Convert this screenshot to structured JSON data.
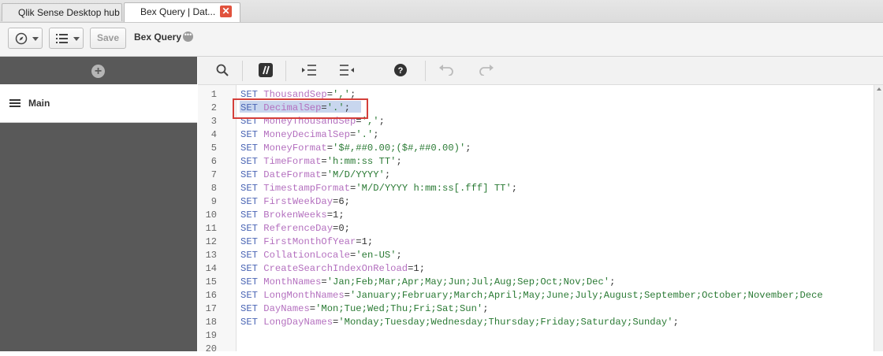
{
  "tabs": [
    {
      "label": "Qlik Sense Desktop hub"
    },
    {
      "label": "Bex Query | Dat..."
    }
  ],
  "toolbar": {
    "save_label": "Save",
    "app_title": "Bex Query"
  },
  "left_panel": {
    "section_label": "Main"
  },
  "editor": {
    "lines": [
      {
        "n": "1",
        "parts": [
          {
            "t": "SET ",
            "c": "kw"
          },
          {
            "t": "ThousandSep",
            "c": "var"
          },
          {
            "t": "=",
            "c": "pun"
          },
          {
            "t": "','",
            "c": "str"
          },
          {
            "t": ";",
            "c": "pun"
          }
        ]
      },
      {
        "n": "2",
        "parts": [
          {
            "t": "SET ",
            "c": "kw"
          },
          {
            "t": "DecimalSep",
            "c": "var"
          },
          {
            "t": "=",
            "c": "pun"
          },
          {
            "t": "'.'",
            "c": "str"
          },
          {
            "t": ";",
            "c": "pun"
          }
        ]
      },
      {
        "n": "3",
        "parts": [
          {
            "t": "SET ",
            "c": "kw"
          },
          {
            "t": "MoneyThousandSep",
            "c": "var"
          },
          {
            "t": "=",
            "c": "pun"
          },
          {
            "t": "','",
            "c": "str"
          },
          {
            "t": ";",
            "c": "pun"
          }
        ]
      },
      {
        "n": "4",
        "parts": [
          {
            "t": "SET ",
            "c": "kw"
          },
          {
            "t": "MoneyDecimalSep",
            "c": "var"
          },
          {
            "t": "=",
            "c": "pun"
          },
          {
            "t": "'.'",
            "c": "str"
          },
          {
            "t": ";",
            "c": "pun"
          }
        ]
      },
      {
        "n": "5",
        "parts": [
          {
            "t": "SET ",
            "c": "kw"
          },
          {
            "t": "MoneyFormat",
            "c": "var"
          },
          {
            "t": "=",
            "c": "pun"
          },
          {
            "t": "'$#,##0.00;($#,##0.00)'",
            "c": "str"
          },
          {
            "t": ";",
            "c": "pun"
          }
        ]
      },
      {
        "n": "6",
        "parts": [
          {
            "t": "SET ",
            "c": "kw"
          },
          {
            "t": "TimeFormat",
            "c": "var"
          },
          {
            "t": "=",
            "c": "pun"
          },
          {
            "t": "'h:mm:ss TT'",
            "c": "str"
          },
          {
            "t": ";",
            "c": "pun"
          }
        ]
      },
      {
        "n": "7",
        "parts": [
          {
            "t": "SET ",
            "c": "kw"
          },
          {
            "t": "DateFormat",
            "c": "var"
          },
          {
            "t": "=",
            "c": "pun"
          },
          {
            "t": "'M/D/YYYY'",
            "c": "str"
          },
          {
            "t": ";",
            "c": "pun"
          }
        ]
      },
      {
        "n": "8",
        "parts": [
          {
            "t": "SET ",
            "c": "kw"
          },
          {
            "t": "TimestampFormat",
            "c": "var"
          },
          {
            "t": "=",
            "c": "pun"
          },
          {
            "t": "'M/D/YYYY h:mm:ss[.fff] TT'",
            "c": "str"
          },
          {
            "t": ";",
            "c": "pun"
          }
        ]
      },
      {
        "n": "9",
        "parts": [
          {
            "t": "SET ",
            "c": "kw"
          },
          {
            "t": "FirstWeekDay",
            "c": "var"
          },
          {
            "t": "=6;",
            "c": "pun"
          }
        ]
      },
      {
        "n": "10",
        "parts": [
          {
            "t": "SET ",
            "c": "kw"
          },
          {
            "t": "BrokenWeeks",
            "c": "var"
          },
          {
            "t": "=1;",
            "c": "pun"
          }
        ]
      },
      {
        "n": "11",
        "parts": [
          {
            "t": "SET ",
            "c": "kw"
          },
          {
            "t": "ReferenceDay",
            "c": "var"
          },
          {
            "t": "=0;",
            "c": "pun"
          }
        ]
      },
      {
        "n": "12",
        "parts": [
          {
            "t": "SET ",
            "c": "kw"
          },
          {
            "t": "FirstMonthOfYear",
            "c": "var"
          },
          {
            "t": "=1;",
            "c": "pun"
          }
        ]
      },
      {
        "n": "13",
        "parts": [
          {
            "t": "SET ",
            "c": "kw"
          },
          {
            "t": "CollationLocale",
            "c": "var"
          },
          {
            "t": "=",
            "c": "pun"
          },
          {
            "t": "'en-US'",
            "c": "str"
          },
          {
            "t": ";",
            "c": "pun"
          }
        ]
      },
      {
        "n": "14",
        "parts": [
          {
            "t": "SET ",
            "c": "kw"
          },
          {
            "t": "CreateSearchIndexOnReload",
            "c": "var"
          },
          {
            "t": "=1;",
            "c": "pun"
          }
        ]
      },
      {
        "n": "15",
        "parts": [
          {
            "t": "SET ",
            "c": "kw"
          },
          {
            "t": "MonthNames",
            "c": "var"
          },
          {
            "t": "=",
            "c": "pun"
          },
          {
            "t": "'Jan;Feb;Mar;Apr;May;Jun;Jul;Aug;Sep;Oct;Nov;Dec'",
            "c": "str"
          },
          {
            "t": ";",
            "c": "pun"
          }
        ]
      },
      {
        "n": "16",
        "parts": [
          {
            "t": "SET ",
            "c": "kw"
          },
          {
            "t": "LongMonthNames",
            "c": "var"
          },
          {
            "t": "=",
            "c": "pun"
          },
          {
            "t": "'January;February;March;April;May;June;July;August;September;October;November;Dece",
            "c": "str"
          }
        ]
      },
      {
        "n": "17",
        "parts": [
          {
            "t": "SET ",
            "c": "kw"
          },
          {
            "t": "DayNames",
            "c": "var"
          },
          {
            "t": "=",
            "c": "pun"
          },
          {
            "t": "'Mon;Tue;Wed;Thu;Fri;Sat;Sun'",
            "c": "str"
          },
          {
            "t": ";",
            "c": "pun"
          }
        ]
      },
      {
        "n": "18",
        "parts": [
          {
            "t": "SET ",
            "c": "kw"
          },
          {
            "t": "LongDayNames",
            "c": "var"
          },
          {
            "t": "=",
            "c": "pun"
          },
          {
            "t": "'Monday;Tuesday;Wednesday;Thursday;Friday;Saturday;Sunday'",
            "c": "str"
          },
          {
            "t": ";",
            "c": "pun"
          }
        ]
      },
      {
        "n": "19",
        "parts": []
      },
      {
        "n": "20",
        "parts": []
      }
    ]
  },
  "colors": {
    "keyword": "#4b66b5",
    "variable": "#b470bf",
    "string": "#2a7a34",
    "highlight_box": "#d43f3a"
  }
}
